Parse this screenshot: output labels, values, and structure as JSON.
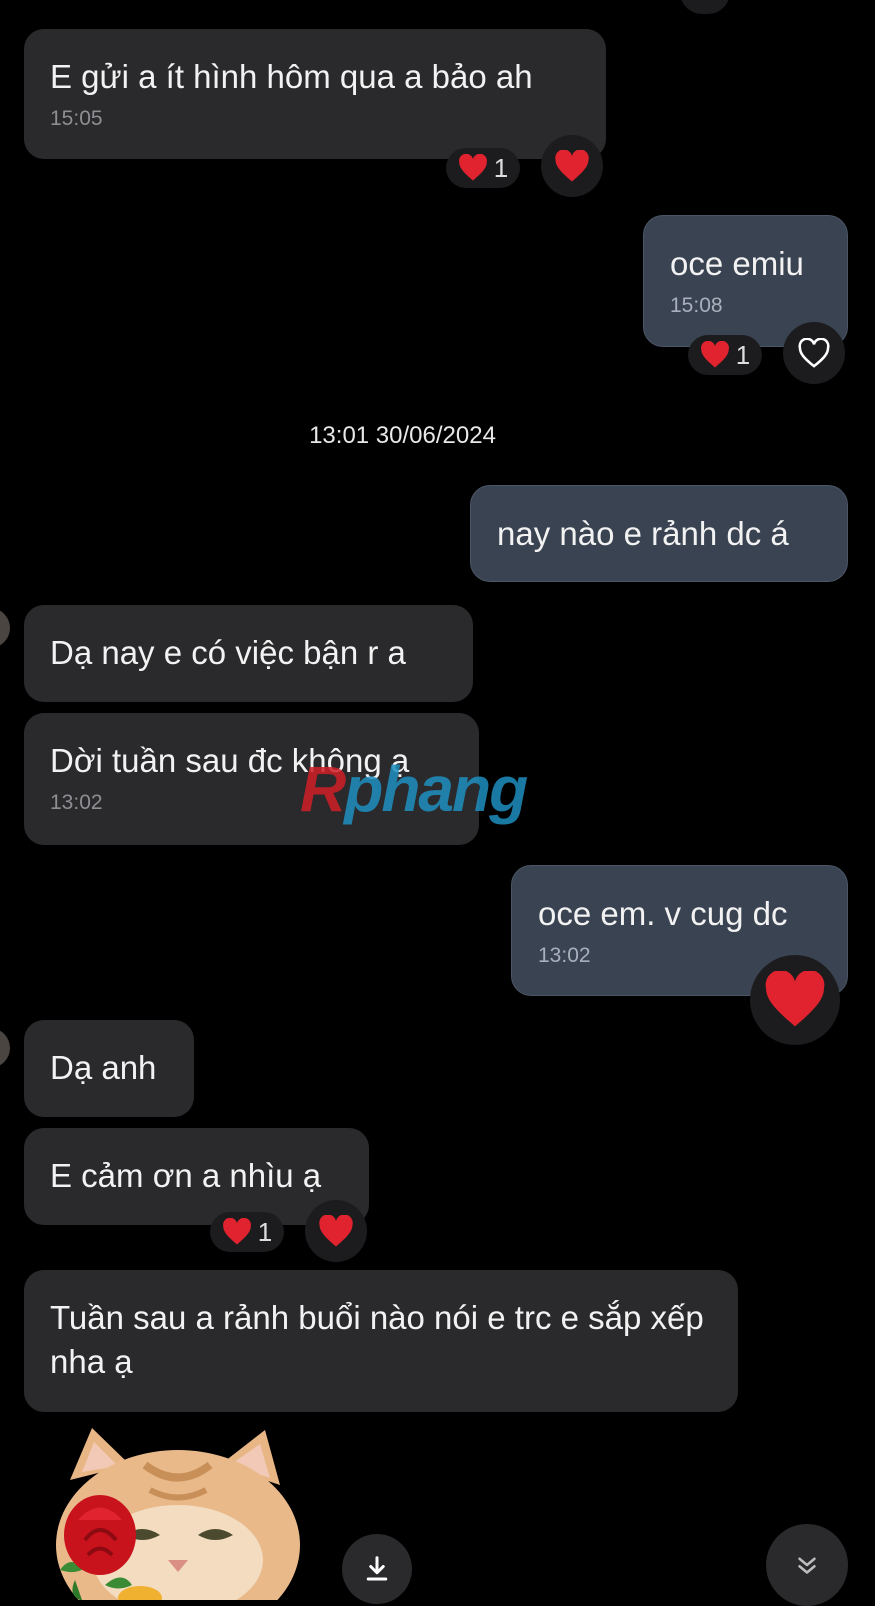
{
  "messages": [
    {
      "text": "E gửi a ít hình hôm qua a bảo ah",
      "time": "15:05",
      "reaction_count": "1"
    },
    {
      "text": "oce emiu",
      "time": "15:08",
      "reaction_count": "1"
    },
    {
      "text": "nay nào e rảnh dc á"
    },
    {
      "text": "Dạ nay e có việc bận r a"
    },
    {
      "text": "Dời tuần sau đc không ạ",
      "time": "13:02"
    },
    {
      "text": "oce em. v cug dc",
      "time": "13:02"
    },
    {
      "text": "Dạ anh"
    },
    {
      "text": "E cảm ơn a nhìu ạ",
      "reaction_count": "1"
    },
    {
      "text": "Tuần sau a rảnh buổi nào nói e trc e sắp xếp nha ạ"
    }
  ],
  "date_divider": "13:01 30/06/2024",
  "watermark": "Rphang",
  "icons": {
    "heart": "heart-icon",
    "heart_outline": "heart-outline-icon",
    "download": "download-icon",
    "scroll_down": "chevron-double-down-icon",
    "sticker": "cat-rose-sticker"
  },
  "colors": {
    "background": "#000000",
    "incoming_bubble": "#2a2a2c",
    "outgoing_bubble": "#3a4351",
    "heart": "#e0232e"
  }
}
